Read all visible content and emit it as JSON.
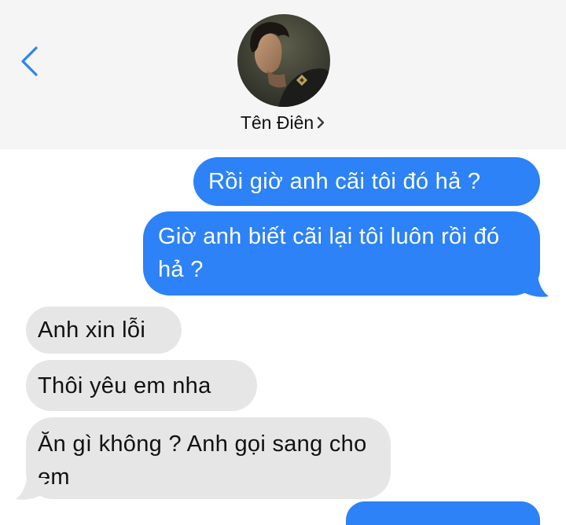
{
  "header": {
    "contact_name": "Tên Điên",
    "icons": {
      "back": "chevron-left-icon",
      "details": "chevron-right-icon",
      "avatar": "contact-avatar"
    }
  },
  "colors": {
    "header_bg": "#f5f5f5",
    "accent_blue": "#2c82f6",
    "incoming_bubble": "#e6e6e6",
    "outgoing_text": "#ffffff",
    "incoming_text": "#111111"
  },
  "messages": [
    {
      "direction": "outgoing",
      "text": "Rồi giờ anh cãi tôi đó hả ?"
    },
    {
      "direction": "outgoing",
      "text": "Giờ anh biết cãi lại tôi luôn rồi đó hả ?"
    },
    {
      "direction": "incoming",
      "text": "Anh xin lỗi"
    },
    {
      "direction": "incoming",
      "text": "Thôi yêu em nha"
    },
    {
      "direction": "incoming",
      "text": "Ăn gì không ? Anh gọi sang cho em"
    }
  ]
}
